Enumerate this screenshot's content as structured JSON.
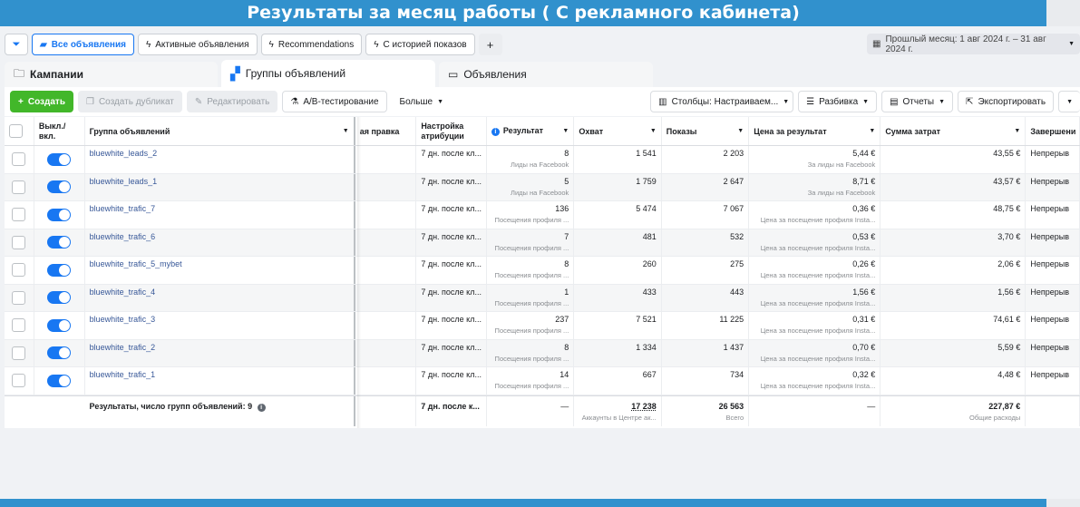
{
  "banner": {
    "title": "Результаты за месяц работы ( С рекламного кабинета)"
  },
  "filters": {
    "all_ads": "Все объявления",
    "active_ads": "Активные объявления",
    "recommendations": "Recommendations",
    "history": "С историей показов",
    "add": "+"
  },
  "date_range": {
    "label": "Прошлый месяц: 1 авг 2024 г. – 31 авг 2024 г."
  },
  "tabs": [
    "Кампании",
    "Группы объявлений",
    "Объявления"
  ],
  "toolbar": {
    "create": "Создать",
    "duplicate": "Создать дубликат",
    "edit": "Редактировать",
    "ab_test": "A/B-тестирование",
    "more": "Больше",
    "columns": "Столбцы: Настраиваем...",
    "breakdown": "Разбивка",
    "reports": "Отчеты",
    "export": "Экспортировать"
  },
  "columns": {
    "toggle": "Выкл./ вкл.",
    "name": "Группа объявлений",
    "attr_partial": "ая правка",
    "attribution": "Настройка атрибуции",
    "result": "Результат",
    "reach": "Охват",
    "impressions": "Показы",
    "cpr": "Цена за результат",
    "spend": "Сумма затрат",
    "end": "Завершени"
  },
  "rows": [
    {
      "name": "bluewhite_leads_2",
      "attr": "7 дн. после кл...",
      "result": "8",
      "result_sub": "Лиды на Facebook",
      "reach": "1 541",
      "impressions": "2 203",
      "cpr": "5,44 €",
      "cpr_sub": "За лиды на Facebook",
      "spend": "43,55 €",
      "end": "Непрерыв"
    },
    {
      "name": "bluewhite_leads_1",
      "attr": "7 дн. после кл...",
      "result": "5",
      "result_sub": "Лиды на Facebook",
      "reach": "1 759",
      "impressions": "2 647",
      "cpr": "8,71 €",
      "cpr_sub": "За лиды на Facebook",
      "spend": "43,57 €",
      "end": "Непрерыв"
    },
    {
      "name": "bluewhite_trafic_7",
      "attr": "7 дн. после кл...",
      "result": "136",
      "result_sub": "Посещения профиля ...",
      "reach": "5 474",
      "impressions": "7 067",
      "cpr": "0,36 €",
      "cpr_sub": "Цена за посещение профиля Insta...",
      "spend": "48,75 €",
      "end": "Непрерыв"
    },
    {
      "name": "bluewhite_trafic_6",
      "attr": "7 дн. после кл...",
      "result": "7",
      "result_sub": "Посещения профиля ...",
      "reach": "481",
      "impressions": "532",
      "cpr": "0,53 €",
      "cpr_sub": "Цена за посещение профиля Insta...",
      "spend": "3,70 €",
      "end": "Непрерыв"
    },
    {
      "name": "bluewhite_trafic_5_mybet",
      "attr": "7 дн. после кл...",
      "result": "8",
      "result_sub": "Посещения профиля ...",
      "reach": "260",
      "impressions": "275",
      "cpr": "0,26 €",
      "cpr_sub": "Цена за посещение профиля Insta...",
      "spend": "2,06 €",
      "end": "Непрерыв"
    },
    {
      "name": "bluewhite_trafic_4",
      "attr": "7 дн. после кл...",
      "result": "1",
      "result_sub": "Посещения профиля ...",
      "reach": "433",
      "impressions": "443",
      "cpr": "1,56 €",
      "cpr_sub": "Цена за посещение профиля Insta...",
      "spend": "1,56 €",
      "end": "Непрерыв"
    },
    {
      "name": "bluewhite_trafic_3",
      "attr": "7 дн. после кл...",
      "result": "237",
      "result_sub": "Посещения профиля ...",
      "reach": "7 521",
      "impressions": "11 225",
      "cpr": "0,31 €",
      "cpr_sub": "Цена за посещение профиля Insta...",
      "spend": "74,61 €",
      "end": "Непрерыв"
    },
    {
      "name": "bluewhite_trafic_2",
      "attr": "7 дн. после кл...",
      "result": "8",
      "result_sub": "Посещения профиля ...",
      "reach": "1 334",
      "impressions": "1 437",
      "cpr": "0,70 €",
      "cpr_sub": "Цена за посещение профиля Insta...",
      "spend": "5,59 €",
      "end": "Непрерыв"
    },
    {
      "name": "bluewhite_trafic_1",
      "attr": "7 дн. после кл...",
      "result": "14",
      "result_sub": "Посещения профиля ...",
      "reach": "667",
      "impressions": "734",
      "cpr": "0,32 €",
      "cpr_sub": "Цена за посещение профиля Insta...",
      "spend": "4,48 €",
      "end": "Непрерыв"
    }
  ],
  "footer": {
    "label": "Результаты, число групп объявлений: 9",
    "attr": "7 дн. после к...",
    "result": "—",
    "reach": "17 238",
    "reach_sub": "Аккаунты в Центре ак...",
    "impressions": "26 563",
    "impressions_sub": "Всего",
    "cpr": "—",
    "spend": "227,87 €",
    "spend_sub": "Общие расходы"
  }
}
